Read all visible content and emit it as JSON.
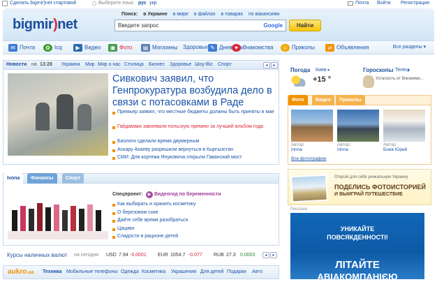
{
  "top": {
    "make_start": "Сделать bigmir)net стартовой",
    "lang_label": "Выберите язык:",
    "lang_ru": "рус",
    "lang_uk": "укр",
    "mail": "Почта",
    "login": "Войти",
    "register": "Регистрация"
  },
  "logo": {
    "a": "bigmir",
    "b": ")",
    "c": "net"
  },
  "search": {
    "label": "Поиск:",
    "tabs": [
      "в Украине",
      "в мире",
      "в файлах",
      "в товарах",
      "по вакансиям"
    ],
    "placeholder": "Введите запрос",
    "provider": "Google",
    "button": "Найти"
  },
  "services": [
    "Почта",
    "Icq",
    "Видео",
    "Фото",
    "Магазины",
    "Здоровье",
    "Дневники",
    "Знакомства",
    "Приколы",
    "Объявления"
  ],
  "services_all": "Все разделы",
  "news": {
    "title": "Новости",
    "time_prefix": "на",
    "time": "13:28",
    "tabs": [
      "Украина",
      "Мир",
      "Мир о нас",
      "Столица",
      "Бизнес",
      "Здоровье",
      "Шоу-Biz",
      "Спорт"
    ],
    "headline": "Сивкович заявил, что Генпрокуратура возбудила дело в связи с потасовками в Раде",
    "items": [
      "Премьер заявил, что местные бюджеты должны быть приняты в мае",
      "Гайдамаки завоевали польскую премию за лучший альбом года",
      "Биологи сделали время двумерным",
      "Аскару Акаеву разрешили вернуться в Кыргызстан",
      "СМИ: Для кортежа Януковича открыли Гаванский мост"
    ]
  },
  "weather": {
    "title": "Погода",
    "city": "Киев",
    "temp": "+15 °"
  },
  "horoscope": {
    "title": "Гороскопы",
    "sign": "Телец",
    "text": "Усталость от близкими..."
  },
  "photo": {
    "tabs": [
      "Фото",
      "Видео",
      "Приколы"
    ],
    "items": [
      {
        "label": "Автор:",
        "author": "irinna"
      },
      {
        "label": "Автор:",
        "author": "irinna"
      },
      {
        "label": "Автор:",
        "author": "Боев Юрий"
      }
    ],
    "all": "Все фотографии"
  },
  "promo": {
    "small": "Открой для себя уникальную Украину",
    "line1": "ПОДЕЛИСЬ ФОТОИСТОРИЕЙ",
    "line2": "И ВЫИГРАЙ ПУТЕШЕСТВИЕ"
  },
  "ad": {
    "label": "Реклама",
    "line1": "УНИКАЙТЕ",
    "line2": "ПОВСЯКДЕННОСТІ!",
    "line3": "ЛІТАЙТЕ",
    "line4": "АВІАКОМПАНІЄЮ"
  },
  "lady": {
    "tabs": [
      "Ivona",
      "Финансы",
      "Спорт"
    ],
    "special_label": "Спецпроект:",
    "special_link": "Видеогид по беременности",
    "items": [
      "Как выбирать и хранить косметику",
      "О березовом соке",
      "Дайте себе время разобраться",
      "Цацики",
      "Сладости в рационе детей"
    ]
  },
  "currency": {
    "title": "Курсы наличных валют",
    "suffix": "на сегодня",
    "rates": [
      {
        "code": "USD",
        "value": "7.94",
        "change": "-0.0001"
      },
      {
        "code": "EUR",
        "value": "1054.7",
        "change": "-0.077"
      },
      {
        "code": "RUB",
        "value": "27.3",
        "change": "0.0003"
      }
    ]
  },
  "aukro": {
    "logo": "aukro",
    "domain": ".ua",
    "cats": [
      "Техника",
      "Мобильные телефоны",
      "Одежда",
      "Косметика",
      "Украшения",
      "Для детей",
      "Подарки",
      "Авто"
    ]
  },
  "colors": {
    "brand": "#1d4e9c",
    "accent_red": "#d9253a",
    "orange": "#f29100"
  }
}
